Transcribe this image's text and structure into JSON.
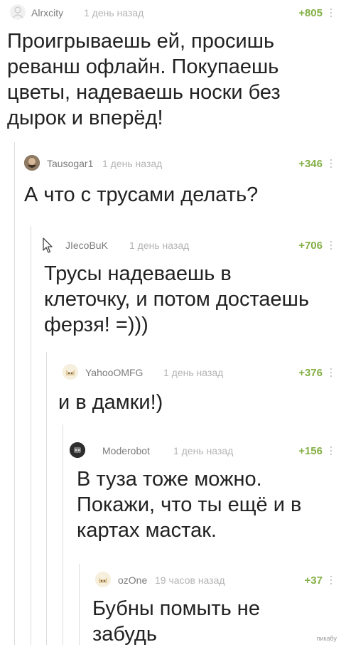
{
  "comments": [
    {
      "username": "Alrxcity",
      "time": "1 день назад",
      "rating": "+805",
      "text": "Проигрываешь ей, просишь\nреванш офлайн. Покупаешь\nцветы, надеваешь носки без\nдырок и вперёд!",
      "avatar_icon": "placeholder-avatar-icon"
    },
    {
      "username": "Tausogar1",
      "time": "1 день назад",
      "rating": "+346",
      "text": "А что с трусами делать?",
      "avatar_icon": "bearded-man-avatar-icon"
    },
    {
      "username": "JIecoBuK",
      "time": "1 день назад",
      "rating": "+706",
      "text": "Трусы надеваешь в\nклеточку, и потом достаешь\nферзя! =)))",
      "avatar_icon": "cursor-pointer-avatar-icon"
    },
    {
      "username": "YahooOMFG",
      "time": "1 день назад",
      "rating": "+376",
      "text": "и в дамки!)",
      "avatar_icon": "cat-avatar-icon"
    },
    {
      "username": "Moderobot",
      "time": "1 день назад",
      "rating": "+156",
      "text": "В туза тоже можно.\nПокажи, что ты ещё и в\nкартах мастак.",
      "avatar_icon": "robot-avatar-icon"
    },
    {
      "username": "ozOne",
      "time": "19 часов назад",
      "rating": "+37",
      "text": "Бубны помыть не\nзабудь",
      "avatar_icon": "cat-avatar-icon"
    }
  ],
  "watermark": "пикабу",
  "colors": {
    "rating": "#83b045",
    "username": "#7c7c7c",
    "time": "#b4b4b4",
    "thread_line": "#dcdcdc",
    "text": "#222222"
  }
}
